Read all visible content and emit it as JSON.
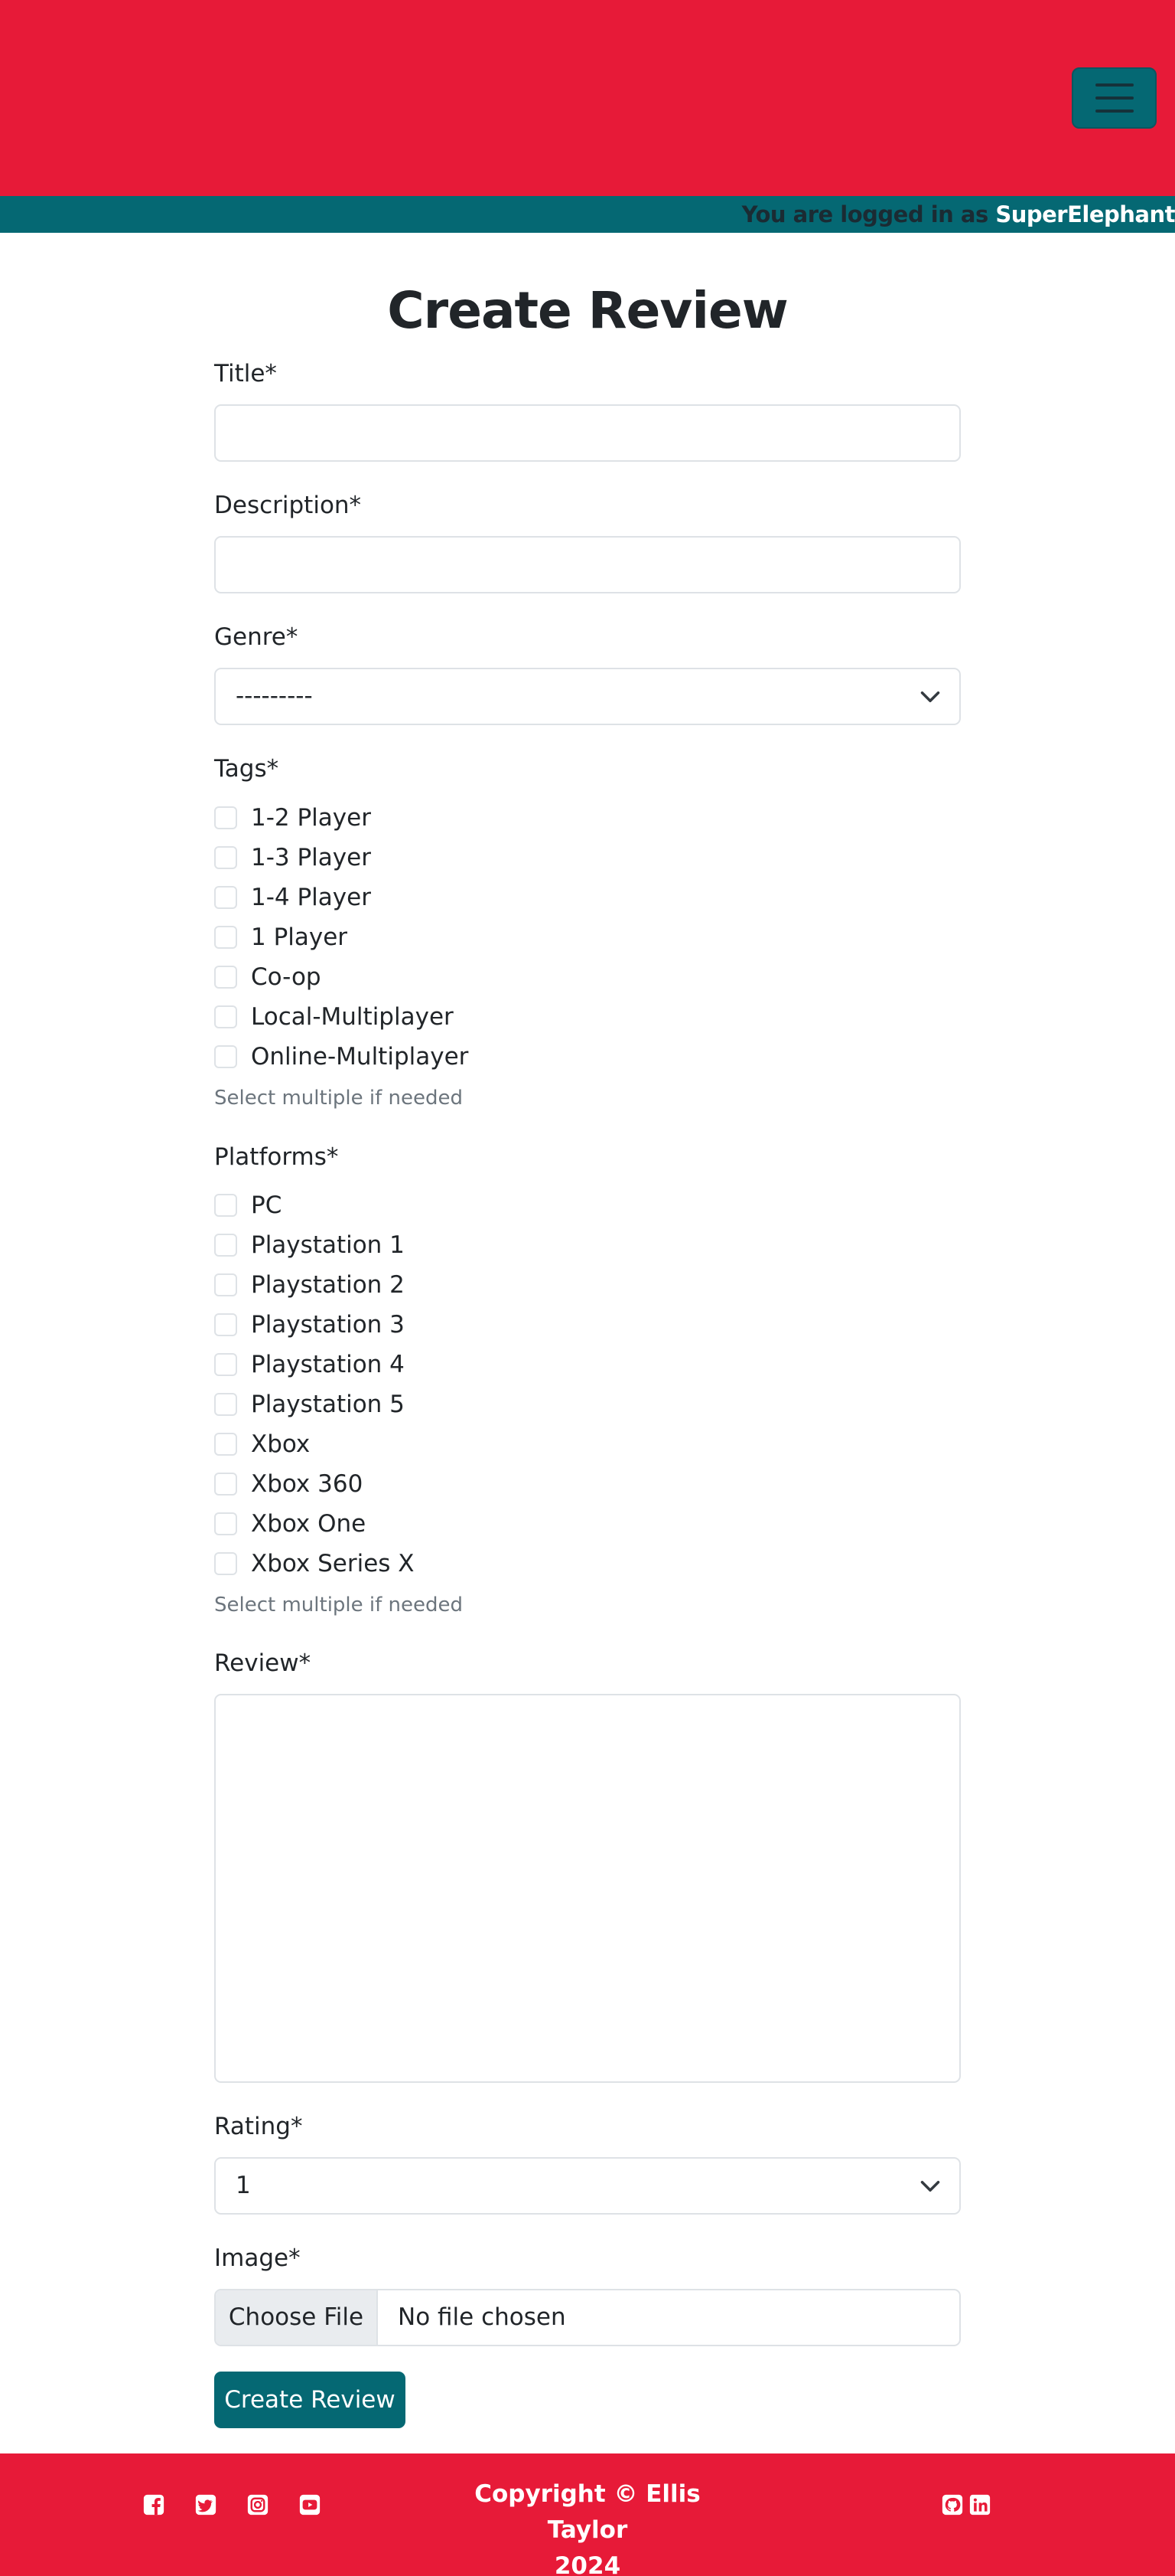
{
  "header": {
    "menu_toggle_label": "Toggle navigation",
    "login_prefix": "You are logged in as",
    "username": "SuperElephant"
  },
  "page": {
    "title": "Create Review"
  },
  "form": {
    "title_label": "Title*",
    "title_value": "",
    "description_label": "Description*",
    "description_value": "",
    "genre_label": "Genre*",
    "genre_selected": "---------",
    "tags_label": "Tags*",
    "tags": [
      "1-2 Player",
      "1-3 Player",
      "1-4 Player",
      "1 Player",
      "Co-op",
      "Local-Multiplayer",
      "Online-Multiplayer"
    ],
    "tags_help": "Select multiple if needed",
    "platforms_label": "Platforms*",
    "platforms": [
      "PC",
      "Playstation 1",
      "Playstation 2",
      "Playstation 3",
      "Playstation 4",
      "Playstation 5",
      "Xbox",
      "Xbox 360",
      "Xbox One",
      "Xbox Series X"
    ],
    "platforms_help": "Select multiple if needed",
    "review_label": "Review*",
    "review_value": "",
    "rating_label": "Rating*",
    "rating_selected": "1",
    "image_label": "Image*",
    "file_button": "Choose File",
    "file_status": "No file chosen",
    "submit_label": "Create Review"
  },
  "footer": {
    "copyright_line1": "Copyright © Ellis Taylor",
    "copyright_line2": "2024",
    "social_icons": [
      "facebook-icon",
      "twitter-icon",
      "instagram-icon",
      "youtube-icon",
      "github-icon",
      "linkedin-icon"
    ]
  },
  "colors": {
    "brand_red": "#e71a38",
    "brand_teal": "#056873",
    "text_dark": "#212529",
    "muted": "#6c757d",
    "border": "#dee2e6"
  }
}
